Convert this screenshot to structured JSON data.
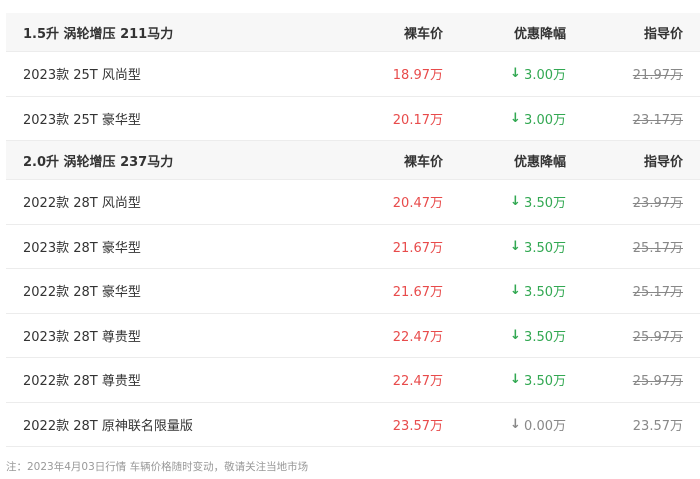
{
  "colors": {
    "price": "#e84b4b",
    "discount": "#32a852",
    "muted": "#888888",
    "header_bg": "#f7f7f7"
  },
  "columns": {
    "price": "裸车价",
    "discount": "优惠降幅",
    "guide": "指导价"
  },
  "groups": [
    {
      "engine": "1.5升 涡轮增压 211马力",
      "models": [
        {
          "name": "2023款 25T 风尚型",
          "price": "18.97万",
          "discount_icon": "arrow-down-icon",
          "discount": "3.00万",
          "guide": "21.97万",
          "guide_struck": true
        },
        {
          "name": "2023款 25T 豪华型",
          "price": "20.17万",
          "discount_icon": "arrow-down-icon",
          "discount": "3.00万",
          "guide": "23.17万",
          "guide_struck": true
        }
      ]
    },
    {
      "engine": "2.0升 涡轮增压 237马力",
      "models": [
        {
          "name": "2022款 28T 风尚型",
          "price": "20.47万",
          "discount_icon": "arrow-down-icon",
          "discount": "3.50万",
          "guide": "23.97万",
          "guide_struck": true
        },
        {
          "name": "2023款 28T 豪华型",
          "price": "21.67万",
          "discount_icon": "arrow-down-icon",
          "discount": "3.50万",
          "guide": "25.17万",
          "guide_struck": true
        },
        {
          "name": "2022款 28T 豪华型",
          "price": "21.67万",
          "discount_icon": "arrow-down-icon",
          "discount": "3.50万",
          "guide": "25.17万",
          "guide_struck": true
        },
        {
          "name": "2023款 28T 尊贵型",
          "price": "22.47万",
          "discount_icon": "arrow-down-icon",
          "discount": "3.50万",
          "guide": "25.97万",
          "guide_struck": true
        },
        {
          "name": "2022款 28T 尊贵型",
          "price": "22.47万",
          "discount_icon": "arrow-down-icon",
          "discount": "3.50万",
          "guide": "25.97万",
          "guide_struck": true
        },
        {
          "name": "2022款 28T 原神联名限量版",
          "price": "23.57万",
          "discount_icon": "arrow-down-icon",
          "discount": "0.00万",
          "guide": "23.57万",
          "guide_struck": false
        }
      ]
    }
  ],
  "note": "注：2023年4月03日行情 车辆价格随时变动，敬请关注当地市场"
}
